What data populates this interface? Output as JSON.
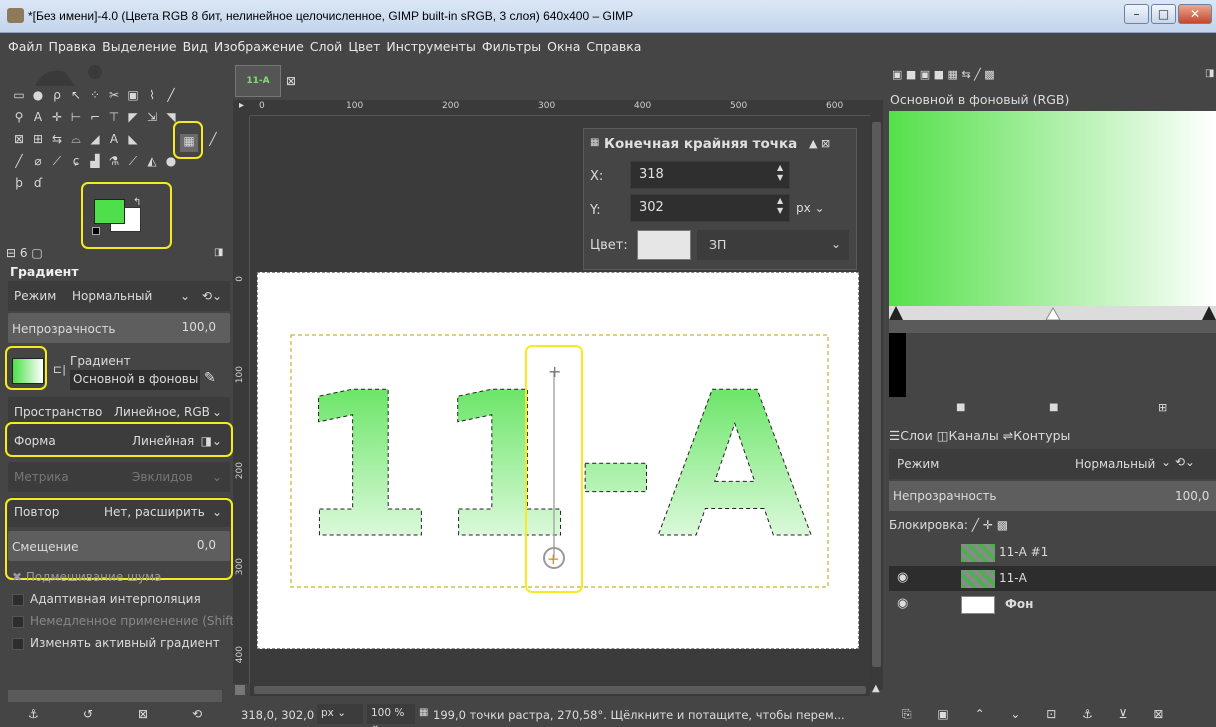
{
  "window": {
    "title": "*[Без имени]-4.0 (Цвета RGB 8 бит, нелинейное целочисленное, GIMP built-in sRGB, 3 слоя) 640x400 – GIMP"
  },
  "menu": [
    "Файл",
    "Правка",
    "Выделение",
    "Вид",
    "Изображение",
    "Слой",
    "Цвет",
    "Инструменты",
    "Фильтры",
    "Окна",
    "Справка"
  ],
  "tool_options": {
    "title": "Градиент",
    "mode_label": "Режим",
    "mode_value": "Нормальный",
    "opacity_label": "Непрозрачность",
    "opacity_value": "100,0",
    "gradient_label": "Градиент",
    "gradient_value": "Основной в фоновы",
    "space_label": "Пространство",
    "space_value": "Линейное, RGB",
    "shape_label": "Форма",
    "shape_value": "Линейная",
    "metric_label": "Метрика",
    "metric_value": "Эвклидов",
    "repeat_label": "Повтор",
    "repeat_value": "Нет, расширить",
    "offset_label": "Смещение",
    "offset_value": "0,0",
    "checks": [
      {
        "label": "Подмешивание шума",
        "checked": true
      },
      {
        "label": "Адаптивная интерполяция",
        "checked": false
      },
      {
        "label": "Немедленное применение (Shift)",
        "checked": false
      },
      {
        "label": "Изменять активный градиент",
        "checked": false
      }
    ]
  },
  "image_tab": {
    "label": "11-А"
  },
  "ruler_marks": [
    "0",
    "100",
    "200",
    "300",
    "400",
    "500",
    "600"
  ],
  "endpoint_dialog": {
    "title": "Конечная крайняя точка",
    "x_label": "X:",
    "x_value": "318",
    "y_label": "Y:",
    "y_value": "302",
    "unit": "px",
    "color_label": "Цвет:",
    "color_value": "ЗП"
  },
  "canvas_text": "11-А",
  "status": {
    "coords": "318,0, 302,0",
    "unit": "px",
    "zoom": "100 %",
    "message": "199,0 точки растра, 270,58°. Щёлкните и потащите, чтобы перем..."
  },
  "gradient_panel": {
    "title": "Основной в фоновый (RGB)"
  },
  "layers_panel": {
    "tabs": [
      "Слои",
      "Каналы",
      "Контуры"
    ],
    "mode_label": "Режим",
    "mode_value": "Нормальный",
    "opacity_label": "Непрозрачность",
    "opacity_value": "100,0",
    "lock_label": "Блокировка:",
    "layers": [
      {
        "name": "11-А #1",
        "visible": false
      },
      {
        "name": "11-А",
        "visible": true
      },
      {
        "name": "Фон",
        "visible": true
      }
    ]
  },
  "colors": {
    "fg": "#4ee04a",
    "bg": "#ffffff",
    "highlight": "#f6ea21"
  }
}
